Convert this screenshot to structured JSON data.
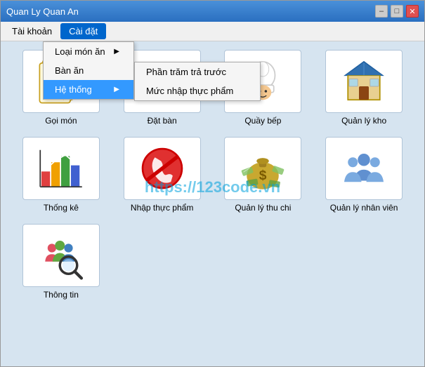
{
  "window": {
    "title": "Quan Ly Quan An",
    "minimize_label": "–",
    "maximize_label": "□",
    "close_label": "✕"
  },
  "menu": {
    "items": [
      {
        "id": "tai-khoan",
        "label": "Tài khoản"
      },
      {
        "id": "cai-dat",
        "label": "Cài đặt"
      }
    ],
    "dropdown": {
      "items": [
        {
          "id": "loai-mon-an",
          "label": "Loại món ăn",
          "has_arrow": true
        },
        {
          "id": "ban-an",
          "label": "Bàn ăn",
          "has_arrow": false
        },
        {
          "id": "he-thong",
          "label": "Hệ thống",
          "has_arrow": true,
          "highlighted": true
        }
      ],
      "submenu": [
        {
          "id": "phan-tram-tra-truoc",
          "label": "Phần trăm trả trước"
        },
        {
          "id": "muc-nhap-thuc-pham",
          "label": "Mức nhập thực phẩm"
        }
      ]
    }
  },
  "icons": [
    {
      "id": "goi-mon",
      "label": "Gọi món"
    },
    {
      "id": "dat-ban",
      "label": "Đặt bàn"
    },
    {
      "id": "quay-bep",
      "label": "Quầy bếp"
    },
    {
      "id": "quan-ly-kho",
      "label": "Quản lý kho"
    },
    {
      "id": "thong-ke",
      "label": "Thống kê"
    },
    {
      "id": "nhap-thuc-pham",
      "label": "Nhập thực phẩm"
    },
    {
      "id": "quan-ly-thu-chi",
      "label": "Quản lý thu chi"
    },
    {
      "id": "quan-ly-nhan-vien",
      "label": "Quản lý nhân viên"
    },
    {
      "id": "thong-tin",
      "label": "Thông tin"
    }
  ],
  "watermark": "https://123code.vn"
}
